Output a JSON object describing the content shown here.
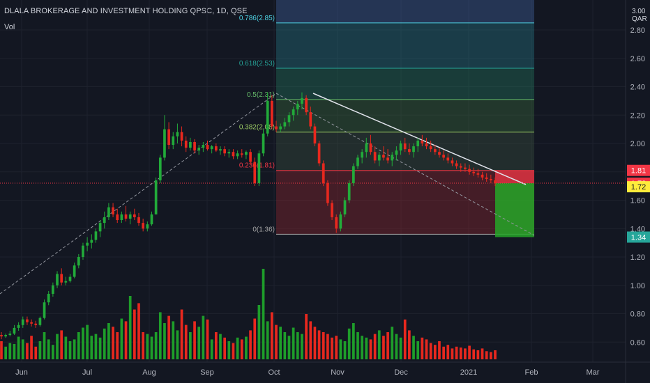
{
  "header": {
    "symbol_title": "DLALA BROKERAGE AND INVESTMENT HOLDING QPSC, 1D, QSE",
    "vol_label": "Vol"
  },
  "axis": {
    "currency_line1": "3.00",
    "currency_line2": "QAR"
  },
  "chart_data": {
    "type": "candlestick",
    "x_ticks": [
      "Jun",
      "Jul",
      "Aug",
      "Sep",
      "Oct",
      "Nov",
      "Dec",
      "2021",
      "Feb",
      "Mar"
    ],
    "y_ticks": [
      "2.80",
      "2.60",
      "2.40",
      "2.20",
      "2.00",
      "1.80",
      "1.60",
      "1.40",
      "1.20",
      "1.00",
      "0.80",
      "0.60"
    ],
    "fib_levels": [
      {
        "label": "0.786(2.85)",
        "value": 2.85,
        "color": "#4dd0e1"
      },
      {
        "label": "0.618(2.53)",
        "value": 2.53,
        "color": "#26a69a"
      },
      {
        "label": "0.5(2.31)",
        "value": 2.31,
        "color": "#66bb6a"
      },
      {
        "label": "0.382(2.08)",
        "value": 2.08,
        "color": "#9ccc65"
      },
      {
        "label": "0.236(1.81)",
        "value": 1.81,
        "color": "#f23645"
      },
      {
        "label": "0(1.36)",
        "value": 1.36,
        "color": "#a6a6a6"
      }
    ],
    "price_badges": [
      {
        "label": "1.81",
        "value": 1.81,
        "bg": "#f23645",
        "fg": "#ffffff"
      },
      {
        "label": "1.72",
        "value": 1.72,
        "bg": "#f23645",
        "fg": "#ffffff"
      },
      {
        "label": "1.72",
        "value": 1.695,
        "bg": "#ffeb3b",
        "fg": "#131722"
      },
      {
        "label": "1.34",
        "value": 1.34,
        "bg": "#26a69a",
        "fg": "#ffffff"
      }
    ],
    "close_price": 1.72,
    "candles": [
      [
        0.65,
        0.67,
        0.62,
        0.64
      ],
      [
        0.64,
        0.66,
        0.63,
        0.65
      ],
      [
        0.65,
        0.68,
        0.64,
        0.66
      ],
      [
        0.66,
        0.72,
        0.65,
        0.7
      ],
      [
        0.7,
        0.74,
        0.68,
        0.72
      ],
      [
        0.72,
        0.78,
        0.7,
        0.76
      ],
      [
        0.76,
        0.78,
        0.72,
        0.74
      ],
      [
        0.74,
        0.76,
        0.71,
        0.73
      ],
      [
        0.73,
        0.75,
        0.7,
        0.72
      ],
      [
        0.72,
        0.78,
        0.71,
        0.77
      ],
      [
        0.77,
        0.9,
        0.76,
        0.88
      ],
      [
        0.88,
        0.96,
        0.86,
        0.94
      ],
      [
        0.94,
        1.02,
        0.92,
        1.0
      ],
      [
        1.0,
        1.1,
        0.98,
        1.08
      ],
      [
        1.08,
        1.12,
        1.0,
        1.02
      ],
      [
        1.02,
        1.06,
        1.0,
        1.03
      ],
      [
        1.03,
        1.08,
        1.02,
        1.06
      ],
      [
        1.06,
        1.16,
        1.05,
        1.14
      ],
      [
        1.14,
        1.22,
        1.12,
        1.2
      ],
      [
        1.2,
        1.3,
        1.18,
        1.28
      ],
      [
        1.28,
        1.34,
        1.24,
        1.3
      ],
      [
        1.3,
        1.36,
        1.26,
        1.32
      ],
      [
        1.32,
        1.4,
        1.3,
        1.38
      ],
      [
        1.38,
        1.46,
        1.34,
        1.44
      ],
      [
        1.44,
        1.52,
        1.4,
        1.48
      ],
      [
        1.48,
        1.58,
        1.46,
        1.55
      ],
      [
        1.55,
        1.58,
        1.48,
        1.5
      ],
      [
        1.5,
        1.54,
        1.44,
        1.46
      ],
      [
        1.46,
        1.52,
        1.44,
        1.5
      ],
      [
        1.5,
        1.56,
        1.45,
        1.47
      ],
      [
        1.47,
        1.52,
        1.43,
        1.5
      ],
      [
        1.5,
        1.54,
        1.46,
        1.48
      ],
      [
        1.48,
        1.51,
        1.42,
        1.44
      ],
      [
        1.44,
        1.47,
        1.38,
        1.4
      ],
      [
        1.4,
        1.45,
        1.38,
        1.43
      ],
      [
        1.43,
        1.52,
        1.42,
        1.5
      ],
      [
        1.5,
        1.76,
        1.5,
        1.74
      ],
      [
        1.74,
        1.92,
        1.72,
        1.9
      ],
      [
        1.9,
        2.2,
        1.88,
        2.1
      ],
      [
        2.1,
        2.15,
        1.96,
        1.99
      ],
      [
        1.99,
        2.08,
        1.96,
        2.05
      ],
      [
        2.05,
        2.14,
        2.0,
        2.08
      ],
      [
        2.08,
        2.12,
        1.98,
        2.02
      ],
      [
        2.02,
        2.05,
        1.94,
        1.97
      ],
      [
        1.97,
        2.04,
        1.95,
        2.01
      ],
      [
        2.01,
        2.03,
        1.93,
        1.95
      ],
      [
        1.95,
        1.99,
        1.92,
        1.97
      ],
      [
        1.97,
        2.01,
        1.94,
        1.99
      ],
      [
        1.99,
        2.02,
        1.95,
        1.96
      ],
      [
        1.96,
        1.99,
        1.93,
        1.98
      ],
      [
        1.98,
        2.0,
        1.94,
        1.95
      ],
      [
        1.95,
        1.98,
        1.92,
        1.96
      ],
      [
        1.96,
        1.98,
        1.91,
        1.93
      ],
      [
        1.93,
        1.96,
        1.9,
        1.94
      ],
      [
        1.94,
        1.96,
        1.89,
        1.91
      ],
      [
        1.91,
        1.95,
        1.89,
        1.93
      ],
      [
        1.93,
        1.96,
        1.9,
        1.92
      ],
      [
        1.92,
        1.95,
        1.89,
        1.94
      ],
      [
        1.94,
        1.96,
        1.85,
        1.87
      ],
      [
        1.87,
        1.9,
        1.7,
        1.72
      ],
      [
        1.72,
        1.95,
        1.7,
        1.93
      ],
      [
        1.93,
        2.1,
        1.91,
        2.07
      ],
      [
        2.07,
        2.36,
        2.05,
        2.3
      ],
      [
        2.3,
        2.34,
        2.1,
        2.12
      ],
      [
        2.12,
        2.16,
        2.08,
        2.1
      ],
      [
        2.1,
        2.14,
        2.08,
        2.12
      ],
      [
        2.12,
        2.18,
        2.1,
        2.15
      ],
      [
        2.15,
        2.22,
        2.12,
        2.2
      ],
      [
        2.2,
        2.26,
        2.16,
        2.24
      ],
      [
        2.24,
        2.3,
        2.2,
        2.28
      ],
      [
        2.28,
        2.36,
        2.24,
        2.32
      ],
      [
        2.32,
        2.34,
        2.2,
        2.22
      ],
      [
        2.22,
        2.26,
        2.1,
        2.12
      ],
      [
        2.12,
        2.14,
        1.98,
        2.0
      ],
      [
        2.0,
        2.02,
        1.84,
        1.86
      ],
      [
        1.86,
        1.88,
        1.7,
        1.72
      ],
      [
        1.72,
        1.74,
        1.56,
        1.58
      ],
      [
        1.58,
        1.6,
        1.46,
        1.48
      ],
      [
        1.48,
        1.5,
        1.37,
        1.4
      ],
      [
        1.4,
        1.52,
        1.38,
        1.5
      ],
      [
        1.5,
        1.62,
        1.48,
        1.6
      ],
      [
        1.6,
        1.74,
        1.58,
        1.72
      ],
      [
        1.72,
        1.86,
        1.7,
        1.84
      ],
      [
        1.84,
        1.92,
        1.82,
        1.9
      ],
      [
        1.9,
        1.96,
        1.86,
        1.94
      ],
      [
        1.94,
        2.04,
        1.9,
        2.0
      ],
      [
        2.0,
        2.06,
        1.92,
        1.94
      ],
      [
        1.94,
        1.98,
        1.86,
        1.88
      ],
      [
        1.88,
        1.94,
        1.84,
        1.92
      ],
      [
        1.92,
        1.98,
        1.88,
        1.9
      ],
      [
        1.9,
        1.96,
        1.86,
        1.88
      ],
      [
        1.88,
        1.94,
        1.84,
        1.92
      ],
      [
        1.92,
        1.98,
        1.88,
        1.95
      ],
      [
        1.95,
        2.02,
        1.92,
        2.0
      ],
      [
        2.0,
        2.04,
        1.94,
        1.96
      ],
      [
        1.96,
        2.0,
        1.92,
        1.94
      ],
      [
        1.94,
        2.0,
        1.9,
        1.98
      ],
      [
        1.98,
        2.04,
        1.94,
        2.02
      ],
      [
        2.02,
        2.06,
        1.98,
        2.0
      ],
      [
        2.0,
        2.04,
        1.96,
        1.98
      ],
      [
        1.98,
        2.02,
        1.94,
        1.96
      ],
      [
        1.96,
        1.99,
        1.92,
        1.94
      ],
      [
        1.94,
        1.97,
        1.9,
        1.92
      ],
      [
        1.92,
        1.95,
        1.88,
        1.9
      ],
      [
        1.9,
        1.93,
        1.86,
        1.88
      ],
      [
        1.88,
        1.9,
        1.84,
        1.86
      ],
      [
        1.86,
        1.88,
        1.82,
        1.84
      ],
      [
        1.84,
        1.86,
        1.8,
        1.83
      ],
      [
        1.83,
        1.86,
        1.8,
        1.82
      ],
      [
        1.82,
        1.85,
        1.78,
        1.8
      ],
      [
        1.8,
        1.83,
        1.77,
        1.79
      ],
      [
        1.79,
        1.82,
        1.76,
        1.78
      ],
      [
        1.78,
        1.8,
        1.74,
        1.76
      ],
      [
        1.76,
        1.79,
        1.73,
        1.75
      ],
      [
        1.75,
        1.78,
        1.72,
        1.74
      ],
      [
        1.74,
        1.76,
        1.7,
        1.72
      ]
    ],
    "volumes": [
      0.2,
      0.14,
      0.18,
      0.17,
      0.25,
      0.22,
      0.18,
      0.26,
      0.14,
      0.2,
      0.3,
      0.22,
      0.16,
      0.28,
      0.32,
      0.25,
      0.2,
      0.22,
      0.3,
      0.35,
      0.38,
      0.26,
      0.28,
      0.24,
      0.34,
      0.4,
      0.36,
      0.3,
      0.45,
      0.42,
      0.7,
      0.55,
      0.62,
      0.3,
      0.28,
      0.25,
      0.3,
      0.52,
      0.4,
      0.48,
      0.42,
      0.32,
      0.55,
      0.38,
      0.3,
      0.42,
      0.36,
      0.48,
      0.44,
      0.22,
      0.3,
      0.28,
      0.24,
      0.2,
      0.18,
      0.24,
      0.22,
      0.25,
      0.32,
      0.45,
      0.6,
      1.0,
      0.42,
      0.52,
      0.38,
      0.36,
      0.3,
      0.26,
      0.35,
      0.3,
      0.28,
      0.5,
      0.42,
      0.36,
      0.32,
      0.3,
      0.28,
      0.24,
      0.26,
      0.22,
      0.2,
      0.34,
      0.4,
      0.3,
      0.26,
      0.24,
      0.22,
      0.28,
      0.32,
      0.26,
      0.3,
      0.36,
      0.28,
      0.24,
      0.44,
      0.32,
      0.26,
      0.2,
      0.24,
      0.22,
      0.18,
      0.16,
      0.2,
      0.14,
      0.16,
      0.12,
      0.14,
      0.13,
      0.12,
      0.15,
      0.11,
      0.1,
      0.12,
      0.09,
      0.08,
      0.1
    ]
  }
}
